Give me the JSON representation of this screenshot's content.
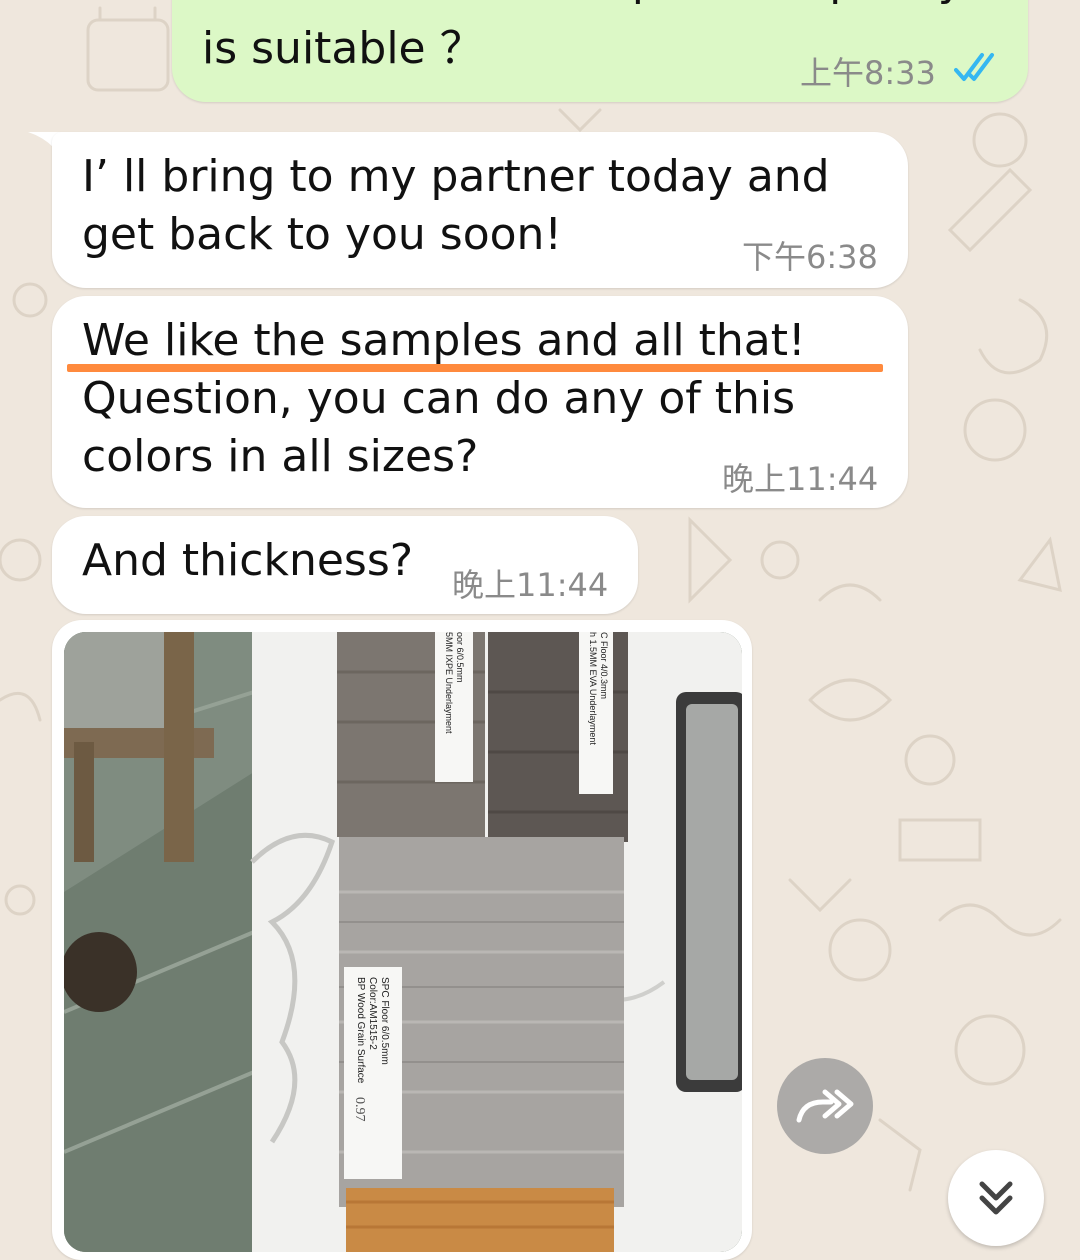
{
  "messages": [
    {
      "id": "m1",
      "direction": "outgoing",
      "text_partial_top": "How about the sample, the quality",
      "text": "is suitable ？",
      "time": "上午8:33",
      "status": "read"
    },
    {
      "id": "m2",
      "direction": "incoming",
      "text": "I’ ll bring to my partner today and\nget back to you soon!",
      "time": "下午6:38"
    },
    {
      "id": "m3",
      "direction": "incoming",
      "text_line1": "We like the samples and all that!",
      "text_rest": "Question, you can do any of this\ncolors in all sizes?",
      "time": "晚上11:44",
      "highlight_color": "#ff8a3d"
    },
    {
      "id": "m4",
      "direction": "incoming",
      "text": "And thickness?",
      "time": "晚上11:44"
    }
  ],
  "photo": {
    "label_main_line1": "SPC Floor 6/0.5mm",
    "label_main_line2": "Color:AM1515-2",
    "label_main_line3": "BP Wood Grain Surface",
    "label_main_handwriting": "0.97",
    "label_left_line1": "oor 6/0.5mm",
    "label_left_line2": "5MM IXPE Underlayment",
    "label_right_line1": "C Floor 4/0.3mm",
    "label_right_line2": "h 1.5MM EVA Underlayment"
  },
  "buttons": {
    "forward_icon": "forward-icon",
    "scroll_icon": "double-chevron-down-icon"
  },
  "colors": {
    "outgoing_bubble": "#dcf8c6",
    "incoming_bubble": "#ffffff",
    "read_ticks": "#34b7f1",
    "wallpaper": "#efe7dd"
  }
}
